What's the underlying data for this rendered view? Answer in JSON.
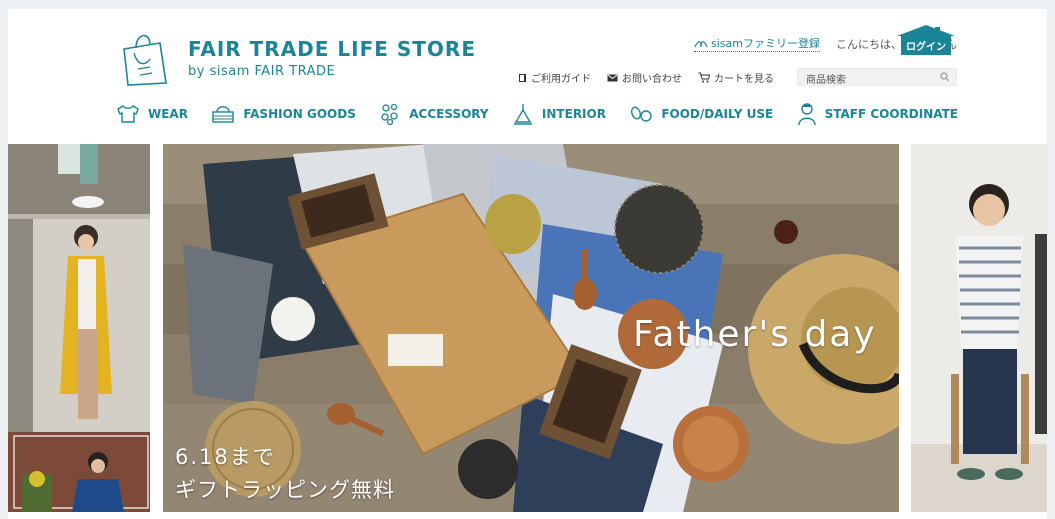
{
  "header": {
    "logo_title": "FAIR TRADE LIFE STORE",
    "logo_sub": "by sisam FAIR TRADE",
    "family_link": "sisamファミリー登録",
    "greeting": "こんにちは、ゲストさん",
    "login_label": "ログイン",
    "util_links": [
      {
        "label": "ご利用ガイド",
        "icon": "book-icon"
      },
      {
        "label": "お問い合わせ",
        "icon": "mail-icon"
      },
      {
        "label": "カートを見る",
        "icon": "cart-icon"
      }
    ],
    "search_placeholder": "商品検索"
  },
  "nav": [
    {
      "label": "WEAR",
      "icon": "shirt-icon"
    },
    {
      "label": "FASHION GOODS",
      "icon": "basket-icon"
    },
    {
      "label": "ACCESSORY",
      "icon": "accessory-icon"
    },
    {
      "label": "INTERIOR",
      "icon": "lamp-icon"
    },
    {
      "label": "FOOD/DAILY USE",
      "icon": "food-icon"
    },
    {
      "label": "STAFF COORDINATE",
      "icon": "staff-icon"
    }
  ],
  "slider": {
    "title": "Father's day",
    "caption_line1": "6.18まで",
    "caption_line2": "ギフトラッピング無料",
    "prev_label": "‹",
    "next_label": "›"
  },
  "colors": {
    "brand": "#1b8597",
    "background": "#eef1f4"
  }
}
